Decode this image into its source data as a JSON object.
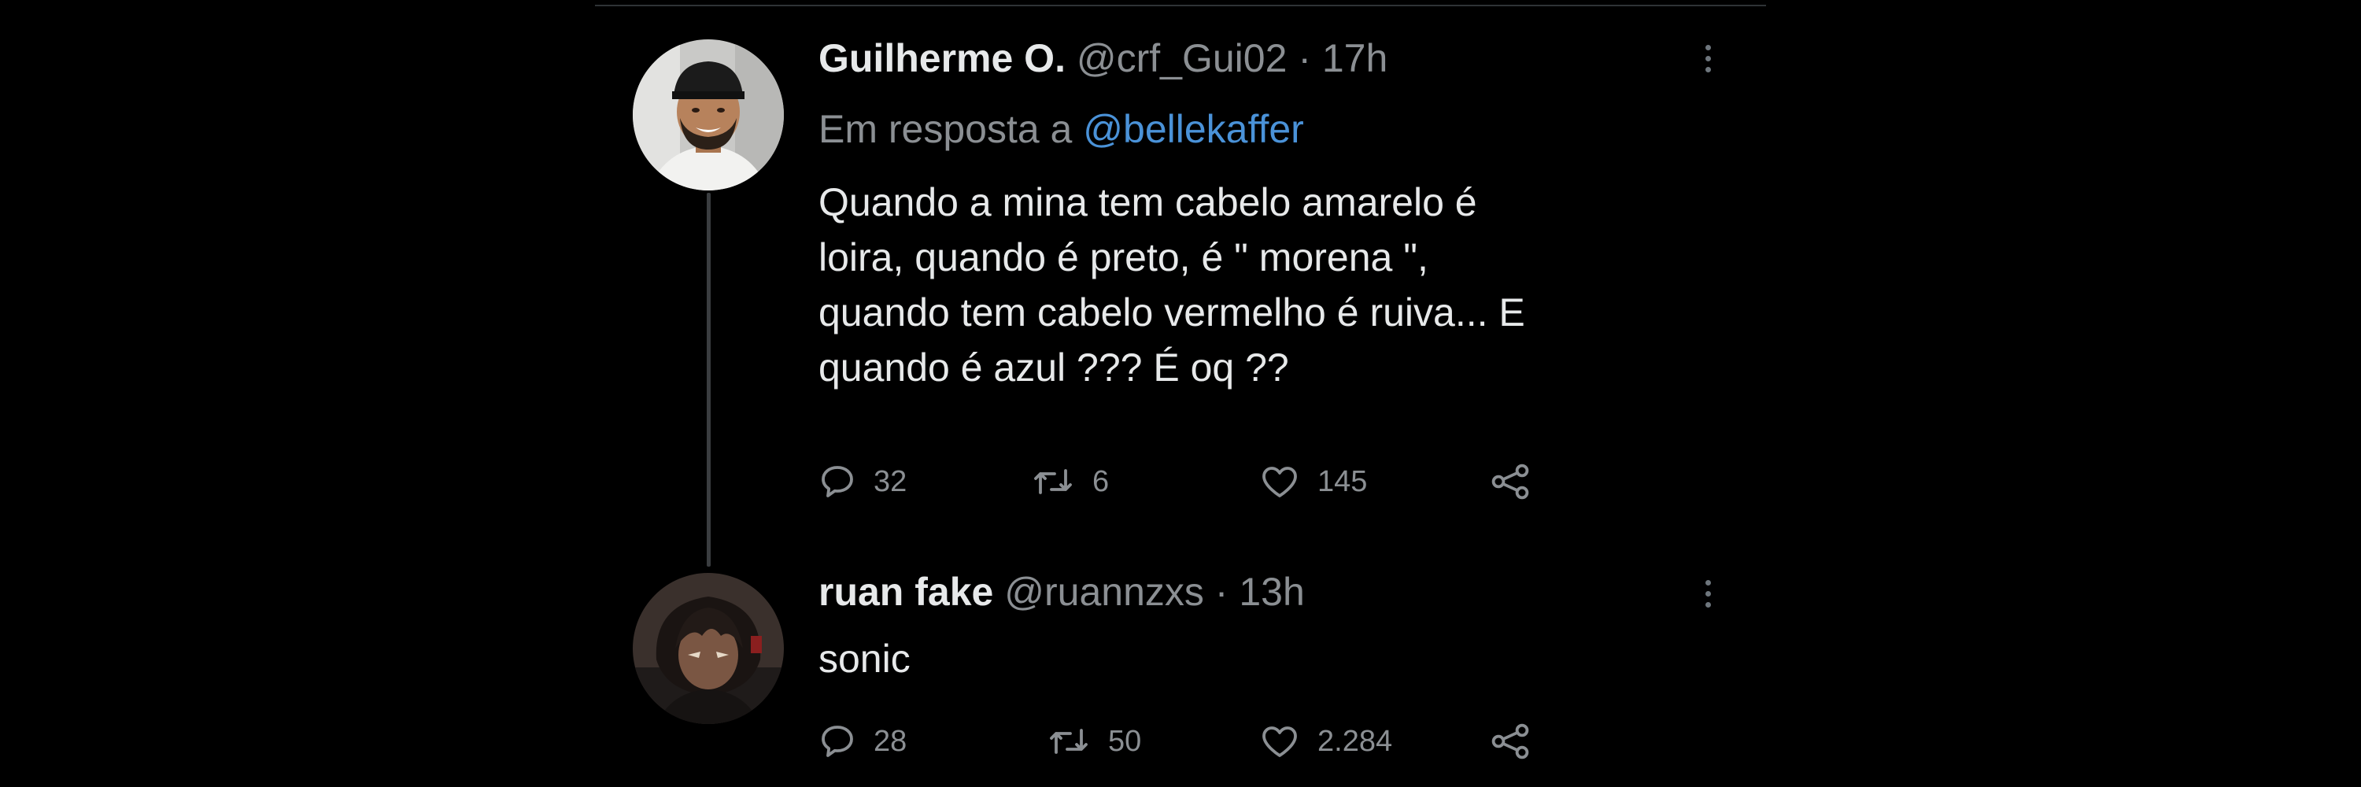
{
  "colors": {
    "background": "#000000",
    "text": "#e7e9ea",
    "muted": "#8b8f93",
    "link": "#4a92d8",
    "thread_line": "#3a3d40"
  },
  "tweets": [
    {
      "name": "Guilherme O.",
      "handle": "@crf_Gui02",
      "dot": "·",
      "time": "17h",
      "reply_prefix": "Em resposta a",
      "reply_handle": "@bellekaffer",
      "text_lines": [
        "Quando a mina tem cabelo amarelo é",
        "loira, quando é preto, é \" morena \",",
        "quando tem cabelo vermelho é ruiva... E",
        "quando é azul ??? É oq ??"
      ],
      "replies": "32",
      "retweets": "6",
      "likes": "145",
      "icons": [
        "reply-icon",
        "retweet-icon",
        "like-icon",
        "share-icon",
        "more-icon"
      ]
    },
    {
      "name": "ruan fake",
      "handle": "@ruannzxs",
      "dot": "·",
      "time": "13h",
      "text_lines": [
        "sonic"
      ],
      "replies": "28",
      "retweets": "50",
      "likes": "2.284",
      "icons": [
        "reply-icon",
        "retweet-icon",
        "like-icon",
        "share-icon",
        "more-icon"
      ]
    }
  ]
}
